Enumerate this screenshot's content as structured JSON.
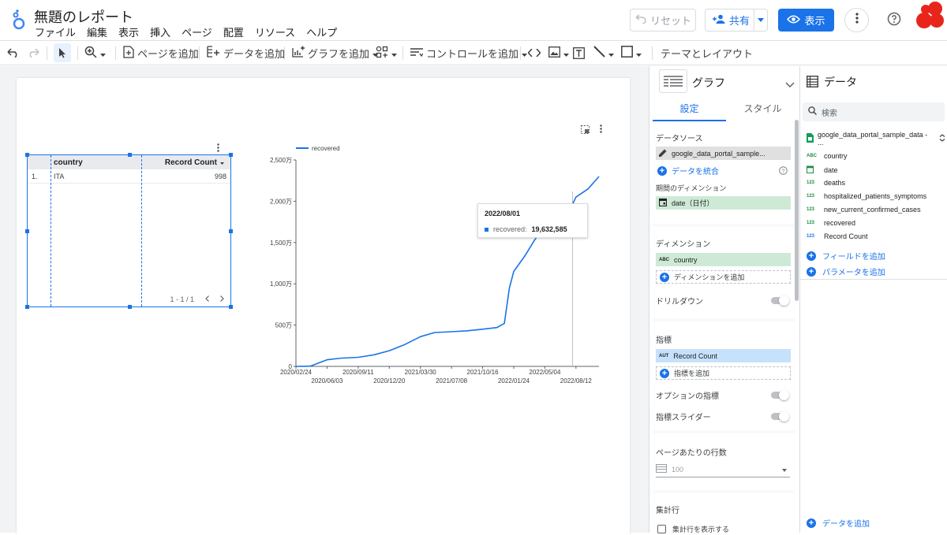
{
  "header": {
    "title": "無題のレポート",
    "menu": [
      "ファイル",
      "編集",
      "表示",
      "挿入",
      "ページ",
      "配置",
      "リソース",
      "ヘルプ"
    ],
    "reset_label": "リセット",
    "share_label": "共有",
    "view_label": "表示"
  },
  "toolbar": {
    "add_page": "ページを追加",
    "add_data": "データを追加",
    "add_chart": "グラフを追加",
    "add_control": "コントロールを追加",
    "theme_layout": "テーマとレイアウト"
  },
  "table": {
    "columns": [
      "country",
      "Record Count"
    ],
    "rows": [
      {
        "index": "1.",
        "country": "ITA",
        "count": "998"
      }
    ],
    "pager": "1 - 1 / 1"
  },
  "chart_data": {
    "type": "line",
    "legend": [
      "recovered"
    ],
    "series": [
      {
        "name": "recovered",
        "color": "#1a73e8",
        "points": [
          [
            "2020-02-24",
            0
          ],
          [
            "2020-04-10",
            30000
          ],
          [
            "2020-06-03",
            800000
          ],
          [
            "2020-07-20",
            1000000
          ],
          [
            "2020-09-11",
            1100000
          ],
          [
            "2020-11-01",
            1400000
          ],
          [
            "2020-12-20",
            1900000
          ],
          [
            "2021-02-05",
            2600000
          ],
          [
            "2021-03-30",
            3600000
          ],
          [
            "2021-05-15",
            4100000
          ],
          [
            "2021-07-08",
            4200000
          ],
          [
            "2021-08-25",
            4300000
          ],
          [
            "2021-10-16",
            4500000
          ],
          [
            "2021-12-01",
            4700000
          ],
          [
            "2021-12-25",
            5200000
          ],
          [
            "2022-01-10",
            9500000
          ],
          [
            "2022-01-24",
            11500000
          ],
          [
            "2022-03-01",
            13400000
          ],
          [
            "2022-04-01",
            15300000
          ],
          [
            "2022-05-04",
            17000000
          ],
          [
            "2022-06-05",
            18500000
          ],
          [
            "2022-07-08",
            19300000
          ],
          [
            "2022-08-01",
            19632585
          ],
          [
            "2022-08-12",
            20500000
          ],
          [
            "2022-09-20",
            21500000
          ],
          [
            "2022-10-25",
            23000000
          ]
        ]
      }
    ],
    "x_ticks_top": [
      "2020/02/24",
      "2020/09/11",
      "2021/03/30",
      "2021/10/16",
      "2022/05/04"
    ],
    "x_ticks_bottom": [
      "2020/06/03",
      "2020/12/20",
      "2021/07/08",
      "2022/01/24",
      "2022/08/12"
    ],
    "y_ticks": [
      "0",
      "500万",
      "1,000万",
      "1,500万",
      "2,000万",
      "2,500万"
    ],
    "ylim": [
      0,
      25000000
    ],
    "grid": false,
    "tooltip": {
      "date": "2022/08/01",
      "label": "recovered:",
      "value": "19,632,585"
    }
  },
  "props": {
    "chart_label": "グラフ",
    "tabs": [
      "設定",
      "スタイル"
    ],
    "data_source_title": "データソース",
    "data_source": "google_data_portal_sample...",
    "blend": "データを統合",
    "date_dim_title": "期間のディメンション",
    "date_dim": "date（日付）",
    "dimension_title": "ディメンション",
    "dimension": "country",
    "add_dimension": "ディメンションを追加",
    "drilldown": "ドリルダウン",
    "metric_title": "指標",
    "metric_type": "AUT",
    "metric": "Record Count",
    "add_metric": "指標を追加",
    "optional_metrics": "オプションの指標",
    "metric_slider": "指標スライダー",
    "rows_per_page_title": "ページあたりの行数",
    "rows_per_page": "100",
    "summary_title": "集計行",
    "show_summary": "集計行を表示する"
  },
  "data_panel": {
    "title": "データ",
    "search_placeholder": "検索",
    "source": "google_data_portal_sample_data - ...",
    "fields": [
      {
        "type": "ABC",
        "name": "country"
      },
      {
        "type": "date",
        "name": "date"
      },
      {
        "type": "123",
        "name": "deaths"
      },
      {
        "type": "123",
        "name": "hospitalized_patients_symptoms"
      },
      {
        "type": "123",
        "name": "new_current_confirmed_cases"
      },
      {
        "type": "123",
        "name": "recovered"
      },
      {
        "type": "123",
        "name": "Record Count"
      }
    ],
    "add_field": "フィールドを追加",
    "add_param": "パラメータを追加",
    "add_data": "データを追加"
  }
}
